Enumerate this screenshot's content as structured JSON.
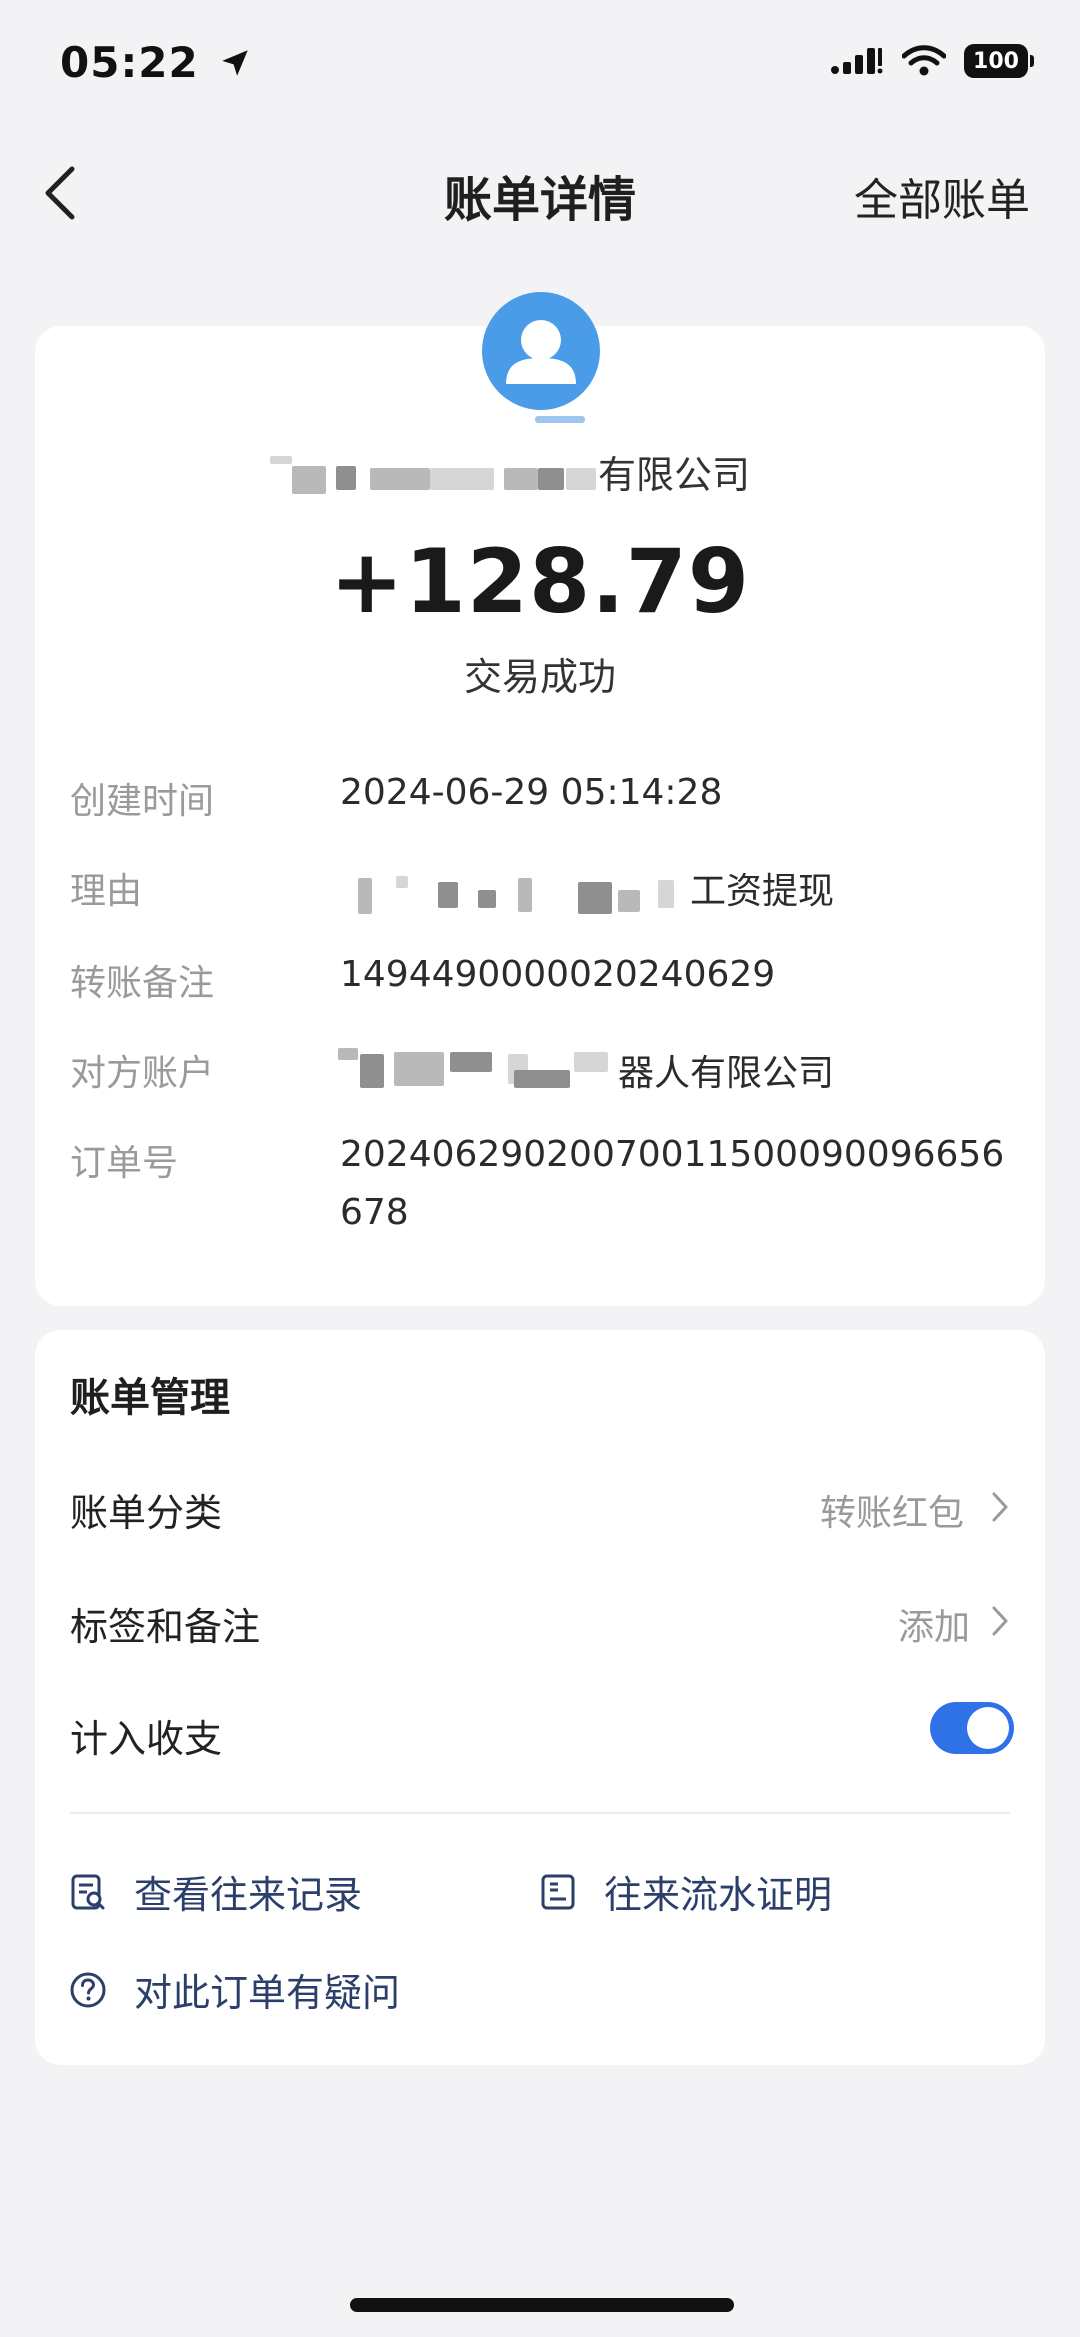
{
  "status_bar": {
    "time": "05:22",
    "battery": "100"
  },
  "nav": {
    "title": "账单详情",
    "right_link": "全部账单"
  },
  "transaction": {
    "payee_visible": "有限公司",
    "amount": "+128.79",
    "status": "交易成功"
  },
  "details": {
    "created_label": "创建时间",
    "created_value": "2024-06-29 05:14:28",
    "reason_label": "理由",
    "reason_value": "工资提现",
    "remark_label": "转账备注",
    "remark_value": "1494490000020240629",
    "account_label": "对方账户",
    "account_value": "器人有限公司",
    "order_label": "订单号",
    "order_value_line1": "20240629020070011500090096656",
    "order_value_line2": "678"
  },
  "management": {
    "title": "账单管理",
    "category_label": "账单分类",
    "category_value": "转账红包",
    "tags_label": "标签和备注",
    "tags_value": "添加",
    "count_label": "计入收支",
    "count_enabled": true,
    "history_link": "查看往来记录",
    "proof_link": "往来流水证明",
    "question_link": "对此订单有疑问"
  },
  "colors": {
    "accent": "#2f72e8",
    "link": "#2b3f6a",
    "avatar": "#4a9be8"
  }
}
